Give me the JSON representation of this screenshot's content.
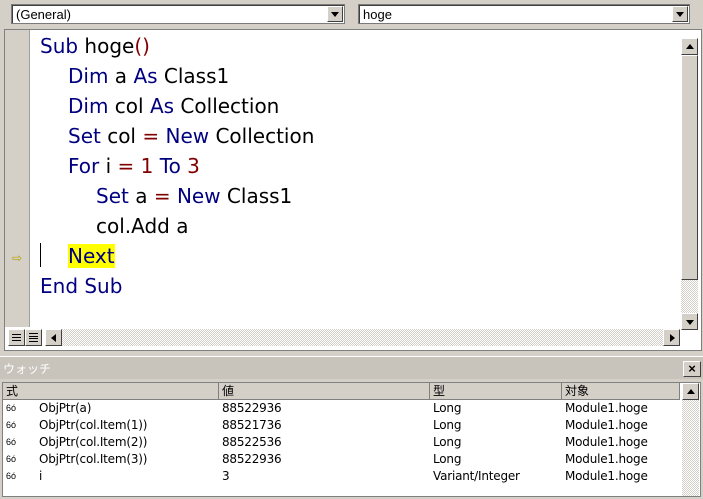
{
  "toolbar": {
    "object_combo": "(General)",
    "procedure_combo": "hoge"
  },
  "code": {
    "l1": {
      "kw1": "Sub",
      "text": " hoge",
      "paren": "()"
    },
    "l2": {
      "kw1": "Dim",
      "t1": " a ",
      "kw2": "As",
      "t2": " Class1"
    },
    "l3": {
      "kw1": "Dim",
      "t1": " col ",
      "kw2": "As",
      "t2": " Collection"
    },
    "l4": {
      "kw1": "Set",
      "t1": " col ",
      "op": "=",
      "sp": " ",
      "kw2": "New",
      "t2": " Collection"
    },
    "l5": {
      "kw1": "For",
      "t1": " i ",
      "op": "=",
      "sp1": " ",
      "n1": "1",
      "sp2": " ",
      "kw2": "To",
      "sp3": " ",
      "n2": "3"
    },
    "l6": {
      "kw1": "Set",
      "t1": " a ",
      "op": "=",
      "sp": " ",
      "kw2": "New",
      "t2": " Class1"
    },
    "l7": {
      "text": "col.Add a"
    },
    "l8": {
      "kw1": "Next"
    },
    "l9": {
      "kw1": "End Sub"
    }
  },
  "watch": {
    "title": "ウォッチ",
    "close_label": "×",
    "columns": [
      "式",
      "値",
      "型",
      "対象"
    ],
    "rows": [
      {
        "expr": "ObjPtr(a)",
        "value": "88522936",
        "type": "Long",
        "context": "Module1.hoge"
      },
      {
        "expr": "ObjPtr(col.Item(1))",
        "value": "88521736",
        "type": "Long",
        "context": "Module1.hoge"
      },
      {
        "expr": "ObjPtr(col.Item(2))",
        "value": "88522536",
        "type": "Long",
        "context": "Module1.hoge"
      },
      {
        "expr": "ObjPtr(col.Item(3))",
        "value": "88522936",
        "type": "Long",
        "context": "Module1.hoge"
      },
      {
        "expr": "i",
        "value": "3",
        "type": "Variant/Integer",
        "context": "Module1.hoge"
      }
    ]
  },
  "colors": {
    "keyword": "#000080",
    "number": "#800000",
    "highlight": "#ffff00",
    "chrome": "#d4d0c8"
  },
  "icons": {
    "exec_pointer": "execution-pointer-icon",
    "watch_row": "watch-glasses-icon"
  }
}
